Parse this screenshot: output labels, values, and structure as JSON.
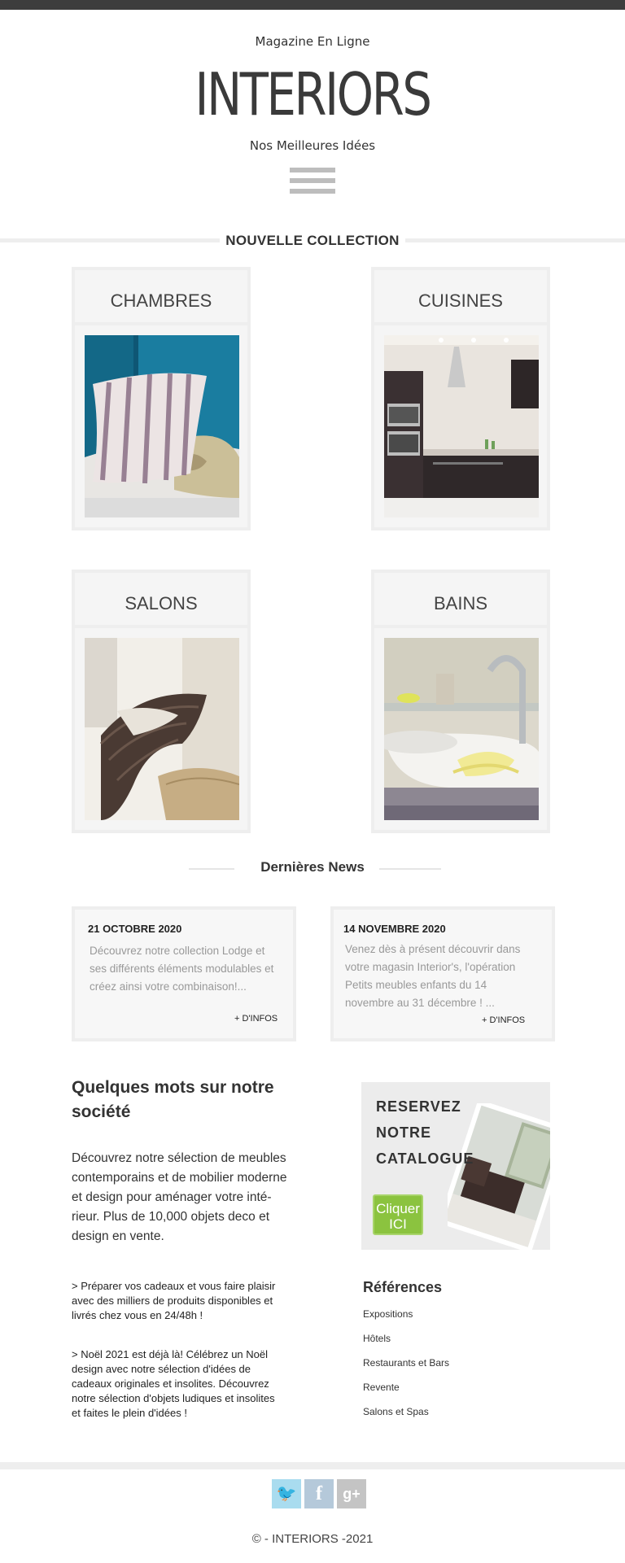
{
  "header": {
    "tagline_top": "Magazine En Ligne",
    "logo": "INTERIORS",
    "tagline_bottom": "Nos Meilleures Idées"
  },
  "collection": {
    "heading": "NOUVELLE COLLECTION",
    "cards": [
      {
        "title": "CHAMBRES"
      },
      {
        "title": "CUISINES"
      },
      {
        "title": "SALONS"
      },
      {
        "title": "BAINS"
      }
    ]
  },
  "news": {
    "heading": "Dernières News",
    "items": [
      {
        "date": "21 OCTOBRE 2020",
        "lines": [
          "Découvrez notre collection Lodge et",
          "ses différents éléments modulables et",
          "créez ainsi votre combinaison!..."
        ],
        "more": "+ D'INFOS"
      },
      {
        "date": "14 NOVEMBRE 2020",
        "lines": [
          "Venez dès à présent découvrir dans",
          "votre magasin Interior's, l'opération",
          "Petits meubles enfants du 14",
          "novembre au 31 décembre ! ..."
        ],
        "more": "+ D'INFOS"
      }
    ]
  },
  "about": {
    "title_lines": [
      "Quelques mots sur notre",
      "société"
    ],
    "text_lines": [
      "Découvrez notre sélection de meubles",
      "contemporains et de mobilier moderne",
      "et design pour aménager votre inté-",
      "rieur. Plus de 10,000 objets deco et",
      "design en vente."
    ],
    "bullet1_lines": [
      "> Préparer vos cadeaux et vous faire plaisir",
      "avec des milliers de produits disponibles et",
      "livrés chez vous en 24/48h !"
    ],
    "bullet2_lines": [
      "> Noël 2021 est déjà là! Célébrez un Noël",
      "design avec notre sélection d'idées de",
      "cadeaux originales et insolites.  Découvrez",
      "notre sélection d'objets ludiques et insolites",
      "et faites le plein d'idées !"
    ]
  },
  "catalog": {
    "lines": [
      "RESERVEZ",
      "NOTRE",
      "CATALOGUE"
    ],
    "button_lines": [
      "Cliquer",
      "ICI"
    ]
  },
  "references": {
    "title": "Références",
    "items": [
      "Expositions",
      "Hôtels",
      "Restaurants et Bars",
      "Revente",
      "Salons et Spas"
    ]
  },
  "footer": {
    "social": [
      {
        "name": "twitter",
        "glyph": "🐦",
        "color": "#a9dcef"
      },
      {
        "name": "facebook",
        "glyph": "f",
        "color": "#b5c9da"
      },
      {
        "name": "google-plus",
        "glyph": "g+",
        "color": "#c4c4c4"
      }
    ],
    "copyright": "© - INTERIORS -2021"
  }
}
